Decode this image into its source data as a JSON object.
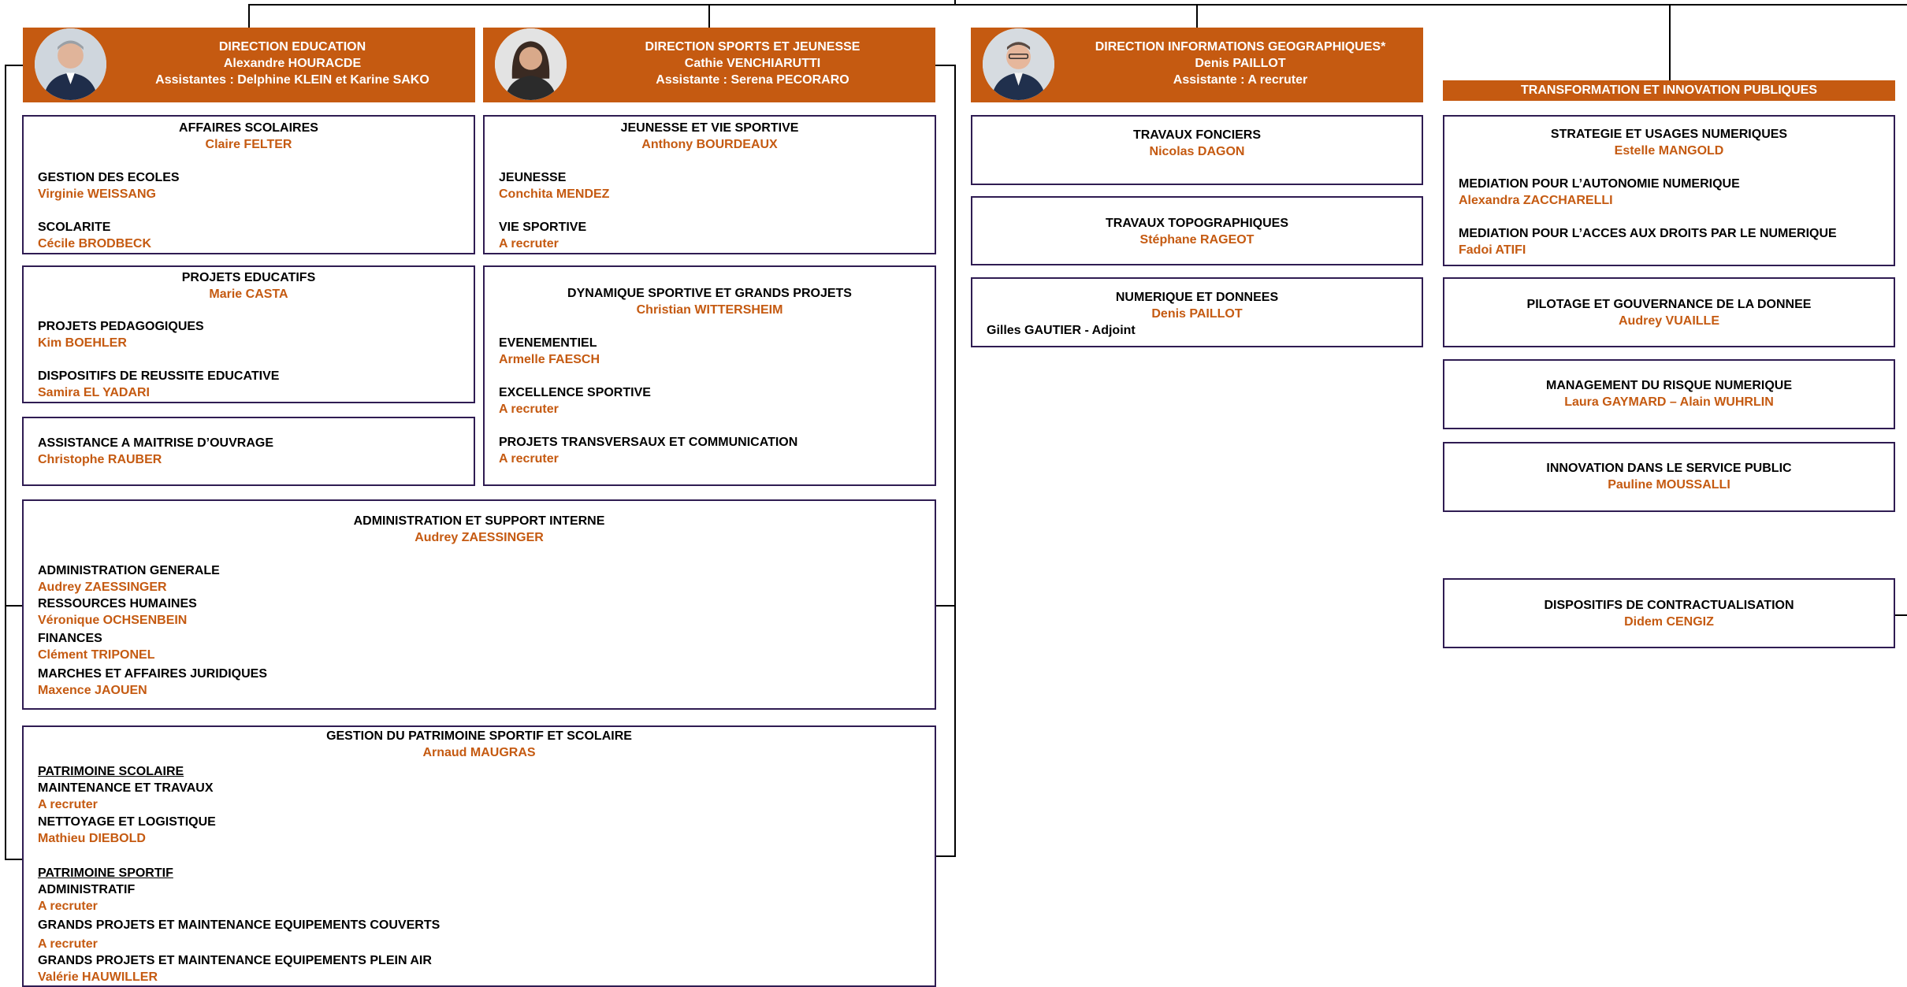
{
  "directions": {
    "education": {
      "title": "DIRECTION EDUCATION",
      "head": "Alexandre HOURACDE",
      "assistants": "Assistantes : Delphine KLEIN et Karine SAKO"
    },
    "sports": {
      "title": "DIRECTION SPORTS ET JEUNESSE",
      "head": "Cathie VENCHIARUTTI",
      "assistants": "Assistante : Serena PECORARO"
    },
    "geo": {
      "title": "DIRECTION INFORMATIONS GEOGRAPHIQUES*",
      "head": "Denis PAILLOT",
      "assistants": "Assistante : A recruter"
    },
    "transfo": {
      "title": "TRANSFORMATION ET INNOVATION PUBLIQUES"
    }
  },
  "education": {
    "affaires": {
      "title": "AFFAIRES SCOLAIRES",
      "head": "Claire FELTER",
      "items": [
        {
          "label": "GESTION DES ECOLES",
          "name": "Virginie WEISSANG"
        },
        {
          "label": "SCOLARITE",
          "name": "Cécile BRODBECK"
        }
      ]
    },
    "projets": {
      "title": "PROJETS EDUCATIFS",
      "head": "Marie CASTA",
      "items": [
        {
          "label": "PROJETS PEDAGOGIQUES",
          "name": "Kim BOEHLER"
        },
        {
          "label": "DISPOSITIFS DE REUSSITE EDUCATIVE",
          "name": "Samira EL YADARI"
        }
      ]
    },
    "amo": {
      "label": "ASSISTANCE A MAITRISE D’OUVRAGE",
      "name": "Christophe RAUBER"
    }
  },
  "sports": {
    "jeunesse": {
      "title": "JEUNESSE ET VIE SPORTIVE",
      "head": "Anthony BOURDEAUX",
      "items": [
        {
          "label": "JEUNESSE",
          "name": "Conchita MENDEZ"
        },
        {
          "label": "VIE SPORTIVE",
          "name": "A recruter"
        }
      ]
    },
    "dynamique": {
      "title": "DYNAMIQUE SPORTIVE ET GRANDS PROJETS",
      "head": "Christian WITTERSHEIM",
      "items": [
        {
          "label": "EVENEMENTIEL",
          "name": "Armelle FAESCH"
        },
        {
          "label": "EXCELLENCE SPORTIVE",
          "name": "A recruter"
        },
        {
          "label": "PROJETS TRANSVERSAUX ET COMMUNICATION",
          "name": "A recruter"
        }
      ]
    }
  },
  "admin": {
    "title": "ADMINISTRATION ET SUPPORT INTERNE",
    "head": "Audrey ZAESSINGER",
    "items": [
      {
        "label": "ADMINISTRATION GENERALE",
        "name": "Audrey ZAESSINGER"
      },
      {
        "label": "RESSOURCES HUMAINES",
        "name": "Véronique OCHSENBEIN"
      },
      {
        "label": "FINANCES",
        "name": "Clément TRIPONEL"
      },
      {
        "label": "MARCHES ET AFFAIRES JURIDIQUES",
        "name": "Maxence JAOUEN"
      }
    ]
  },
  "patrimoine": {
    "title": "GESTION DU PATRIMOINE SPORTIF ET SCOLAIRE",
    "head": "Arnaud MAUGRAS",
    "scolaire": {
      "heading": "PATRIMOINE SCOLAIRE",
      "items": [
        {
          "label": "MAINTENANCE ET TRAVAUX",
          "name": "A recruter"
        },
        {
          "label": "NETTOYAGE ET LOGISTIQUE",
          "name": "Mathieu DIEBOLD"
        }
      ]
    },
    "sportif": {
      "heading": "PATRIMOINE SPORTIF",
      "items": [
        {
          "label": "ADMINISTRATIF",
          "name": "A recruter"
        },
        {
          "label": "GRANDS PROJETS ET MAINTENANCE EQUIPEMENTS COUVERTS",
          "name": "A recruter"
        },
        {
          "label": "GRANDS PROJETS ET MAINTENANCE EQUIPEMENTS PLEIN AIR",
          "name": "Valérie HAUWILLER"
        }
      ]
    }
  },
  "geo": {
    "fonciers": {
      "title": "TRAVAUX FONCIERS",
      "head": "Nicolas DAGON"
    },
    "topo": {
      "title": "TRAVAUX TOPOGRAPHIQUES",
      "head": "Stéphane RAGEOT"
    },
    "numerique": {
      "title": "NUMERIQUE ET DONNEES",
      "head": "Denis PAILLOT",
      "deputy": "Gilles GAUTIER - Adjoint"
    }
  },
  "transfo": {
    "strategie": {
      "title": "STRATEGIE ET USAGES NUMERIQUES",
      "head": "Estelle MANGOLD",
      "items": [
        {
          "label": "MEDIATION POUR L’AUTONOMIE NUMERIQUE",
          "name": "Alexandra ZACCHARELLI"
        },
        {
          "label": "MEDIATION POUR L’ACCES AUX DROITS PAR LE NUMERIQUE",
          "name": "Fadoi ATIFI"
        }
      ]
    },
    "pilotage": {
      "title": "PILOTAGE ET GOUVERNANCE DE LA DONNEE",
      "head": "Audrey VUAILLE"
    },
    "risque": {
      "title": "MANAGEMENT DU RISQUE NUMERIQUE",
      "head": "Laura GAYMARD – Alain WUHRLIN"
    },
    "innovation": {
      "title": "INNOVATION DANS LE SERVICE PUBLIC",
      "head": "Pauline MOUSSALLI"
    },
    "contract": {
      "title": "DISPOSITIFS DE CONTRACTUALISATION",
      "head": "Didem CENGIZ"
    }
  },
  "colors": {
    "accent": "#c55a11",
    "border": "#2f1c52"
  },
  "icons": {
    "education_photo": "person-photo-icon",
    "sports_photo": "person-photo-icon",
    "geo_photo": "person-photo-icon"
  }
}
